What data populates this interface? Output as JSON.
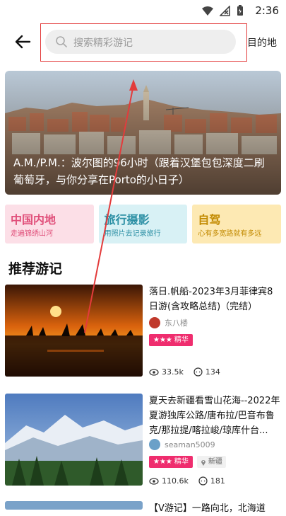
{
  "status": {
    "time": "2:36"
  },
  "header": {
    "search_placeholder": "搜索精彩游记",
    "destination": "目的地"
  },
  "hero": {
    "caption": "A.M./P.M.：波尔图的96小时（跟着汉堡包包深度二刷葡萄牙，与你分享在Porto的小日子）"
  },
  "categories": [
    {
      "title": "中国内地",
      "subtitle": "走遍锦绣山河"
    },
    {
      "title": "旅行摄影",
      "subtitle": "用照片去记录旅行"
    },
    {
      "title": "自驾",
      "subtitle": "心有多宽路就有多远"
    }
  ],
  "section_title": "推荐游记",
  "cards": [
    {
      "title": "落日.帆船-2023年3月菲律宾8日游(含攻略总结)（完结）",
      "author": "东八楼",
      "badge": "精华",
      "location": "",
      "views": "33.5k",
      "comments": "134"
    },
    {
      "title": "夏天去新疆看雪山花海--2022年夏游独库公路/唐布拉/巴音布鲁克/那拉提/喀拉峻/琼库什台...",
      "author": "seaman5009",
      "badge": "精华",
      "location": "新疆",
      "views": "110.6k",
      "comments": "181"
    },
    {
      "title": "【V游记】一路向北，北海道"
    }
  ],
  "colors": {
    "annotation_red": "#e33b3b",
    "badge_pink": "#ef2d6e"
  }
}
